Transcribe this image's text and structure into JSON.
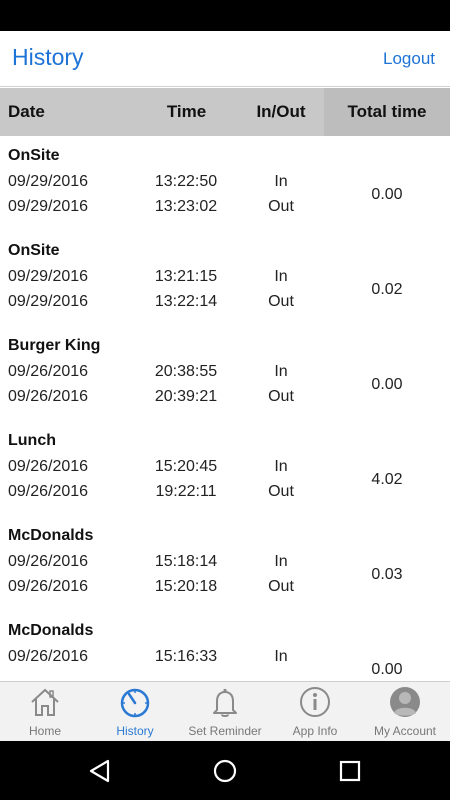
{
  "header": {
    "title": "History",
    "logout_label": "Logout"
  },
  "columns": {
    "date": "Date",
    "time": "Time",
    "in_out": "In/Out",
    "total": "Total time"
  },
  "entries": [
    {
      "name": "OnSite",
      "total": "0.00",
      "rows": [
        {
          "date": "09/29/2016",
          "time": "13:22:50",
          "dir": "In"
        },
        {
          "date": "09/29/2016",
          "time": "13:23:02",
          "dir": "Out"
        }
      ]
    },
    {
      "name": "OnSite",
      "total": "0.02",
      "rows": [
        {
          "date": "09/29/2016",
          "time": "13:21:15",
          "dir": "In"
        },
        {
          "date": "09/29/2016",
          "time": "13:22:14",
          "dir": "Out"
        }
      ]
    },
    {
      "name": "Burger King",
      "total": "0.00",
      "rows": [
        {
          "date": "09/26/2016",
          "time": "20:38:55",
          "dir": "In"
        },
        {
          "date": "09/26/2016",
          "time": "20:39:21",
          "dir": "Out"
        }
      ]
    },
    {
      "name": "Lunch",
      "total": "4.02",
      "rows": [
        {
          "date": "09/26/2016",
          "time": "15:20:45",
          "dir": "In"
        },
        {
          "date": "09/26/2016",
          "time": "19:22:11",
          "dir": "Out"
        }
      ]
    },
    {
      "name": "McDonalds",
      "total": "0.03",
      "rows": [
        {
          "date": "09/26/2016",
          "time": "15:18:14",
          "dir": "In"
        },
        {
          "date": "09/26/2016",
          "time": "15:20:18",
          "dir": "Out"
        }
      ]
    },
    {
      "name": "McDonalds",
      "total": "0.00",
      "rows": [
        {
          "date": "09/26/2016",
          "time": "15:16:33",
          "dir": "In"
        }
      ]
    }
  ],
  "tabs": [
    {
      "label": "Home",
      "icon": "home-icon",
      "active": false
    },
    {
      "label": "History",
      "icon": "clock-icon",
      "active": true
    },
    {
      "label": "Set Reminder",
      "icon": "bell-icon",
      "active": false
    },
    {
      "label": "App Info",
      "icon": "info-icon",
      "active": false
    },
    {
      "label": "My Account",
      "icon": "user-icon",
      "active": false
    }
  ],
  "colors": {
    "accent": "#1e73d6",
    "header_bg": "#c8c8c8",
    "tabbar_bg": "#f2f2f2"
  }
}
